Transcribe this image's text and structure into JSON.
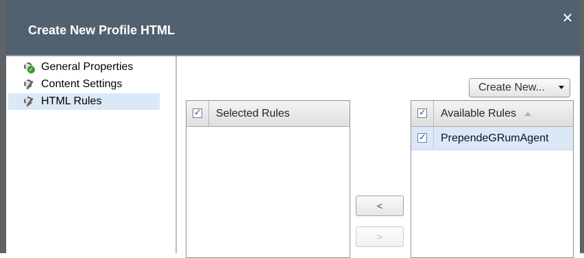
{
  "dialog": {
    "title": "Create New Profile HTML",
    "close_icon": "close-icon"
  },
  "nav": {
    "items": [
      {
        "label": "General Properties",
        "icon": "gear-check-icon",
        "selected": false
      },
      {
        "label": "Content Settings",
        "icon": "gear-icon",
        "selected": false
      },
      {
        "label": "HTML Rules",
        "icon": "gear-icon",
        "selected": true
      }
    ]
  },
  "toolbar": {
    "create_new_label": "Create New..."
  },
  "selected_rules": {
    "header": "Selected Rules",
    "header_checked": true,
    "rows": []
  },
  "available_rules": {
    "header": "Available Rules",
    "header_checked": true,
    "sort": "ascending",
    "rows": [
      {
        "label": "PrependeGRumAgent",
        "checked": true,
        "selected": true
      }
    ]
  },
  "move": {
    "left_label": "<",
    "right_label": ">"
  },
  "colors": {
    "titlebar": "#526272",
    "selection": "#dbe8f8",
    "border": "#5f6366"
  }
}
